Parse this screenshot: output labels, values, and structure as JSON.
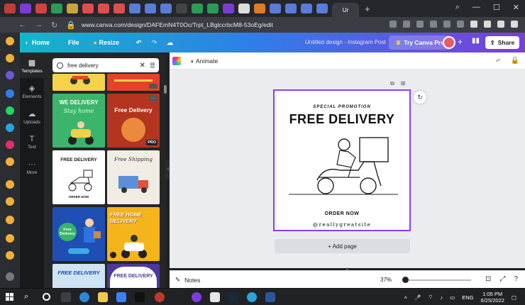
{
  "browser": {
    "active_tab_label": "Ur",
    "url": "www.canva.com/design/DAFEmN4T0Oc/Trpt_LBglccrbcM8-53oEg/edit"
  },
  "canva_header": {
    "home_label": "Home",
    "file_label": "File",
    "resize_label": "Resize",
    "design_title": "Untitled design - Instagram Post",
    "try_pro_label": "Try Canva Pro",
    "share_label": "Share"
  },
  "rail": {
    "items": [
      {
        "label": "Templates",
        "icon": "templates-icon"
      },
      {
        "label": "Elements",
        "icon": "elements-icon"
      },
      {
        "label": "Uploads",
        "icon": "uploads-icon"
      },
      {
        "label": "Text",
        "icon": "text-icon"
      },
      {
        "label": "More",
        "icon": "more-icon"
      }
    ]
  },
  "search": {
    "query": "free delivery"
  },
  "templates": [
    {
      "title": "",
      "bg": "#f5d24a"
    },
    {
      "title": "",
      "bg": "#e8412a"
    },
    {
      "title": "WE DELIVERY",
      "subtitle": "Stay home",
      "bg": "#3bb56c"
    },
    {
      "title": "Free Delivery",
      "bg": "#b3341f"
    },
    {
      "title": "FREE DELIVERY",
      "subtitle": "ORDER NOW",
      "bg": "#ffffff"
    },
    {
      "title": "Free Shipping",
      "bg": "#f1ece4"
    },
    {
      "title": "Free Delivery",
      "bg": "#1f4fb3"
    },
    {
      "title": "FREE HOME DELIVERY",
      "bg": "#f6b41b"
    },
    {
      "title": "FREE DELIVERY",
      "bg": "#cfe4f3"
    },
    {
      "title": "FREE DELIVERY",
      "bg": "#4b3a9c"
    }
  ],
  "pro_badge": "PRO",
  "toolbar": {
    "animate_label": "Animate"
  },
  "design": {
    "special_label": "SPECIAL PROMOTION",
    "headline": "FREE DELIVERY",
    "cta": "ORDER NOW",
    "website": "@reallygreatsite"
  },
  "add_page_label": "+ Add page",
  "statusbar": {
    "notes_label": "Notes",
    "zoom": "37%"
  },
  "taskbar": {
    "language": "ENG",
    "time": "1:05 PM",
    "date": "6/25/2022"
  },
  "colors": {
    "canva_purple": "#8b3dff",
    "header_start": "#13b6c9",
    "header_end": "#7b3ddb"
  }
}
